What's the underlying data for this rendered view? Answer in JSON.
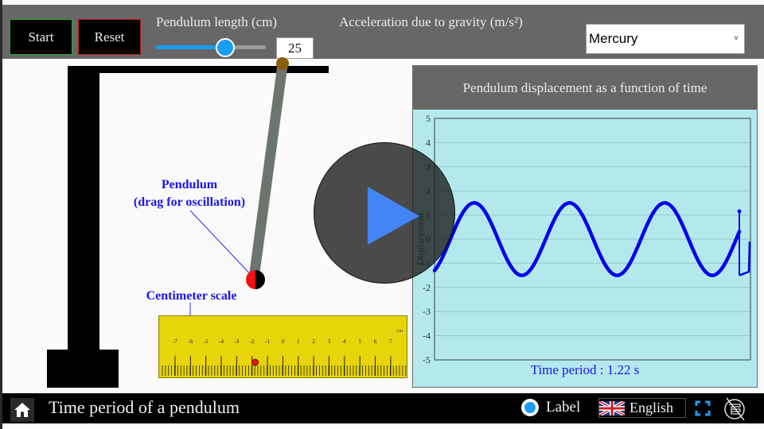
{
  "toolbar": {
    "start_label": "Start",
    "reset_label": "Reset",
    "length_label": "Pendulum length (cm)",
    "length_value": "25",
    "length_slider_fraction": 0.63,
    "gravity_label": "Acceleration due to gravity (m/s²)",
    "planet_selected": "Mercury",
    "caret_glyph": "˅"
  },
  "scene": {
    "pendulum_label_line1": "Pendulum",
    "pendulum_label_line2": "(drag for oscillation)",
    "scale_label": "Centimeter scale",
    "ruler": {
      "unit": "cm",
      "ticks": [
        "-7",
        "-6",
        "-5",
        "-4",
        "-3",
        "-2",
        "-1",
        "0",
        "1",
        "2",
        "3",
        "4",
        "5",
        "6",
        "7"
      ],
      "marker_value_cm": -1.8
    }
  },
  "graph": {
    "title": "Pendulum displacement as a function of time",
    "period_text": "Time period : 1.22 s"
  },
  "chart_data": {
    "type": "line",
    "title": "Pendulum displacement as a function of time",
    "xlabel": "",
    "ylabel": "Displacement",
    "ylim": [
      -5,
      5
    ],
    "yticks": [
      "5",
      "4",
      "3",
      "2",
      "1",
      "0",
      "-1",
      "-2",
      "-3",
      "-4",
      "-5"
    ],
    "grid": true,
    "series": [
      {
        "name": "displacement",
        "color": "#0000ee",
        "amplitude": 1.5,
        "cycles_shown": 3.2,
        "start_value": -1.3,
        "end_point": 1.15
      }
    ],
    "annotation": "Time period : 1.22 s"
  },
  "bottombar": {
    "title": "Time period of a pendulum",
    "label_toggle": "Label",
    "language": "English"
  },
  "colors": {
    "accent_blue": "#1a9cf2",
    "label_blue": "#1a16f0",
    "graph_bg": "#b3e9ed",
    "ruler_yellow": "#e8d40a",
    "start_border": "#22b022",
    "reset_border": "#c01c1c"
  }
}
